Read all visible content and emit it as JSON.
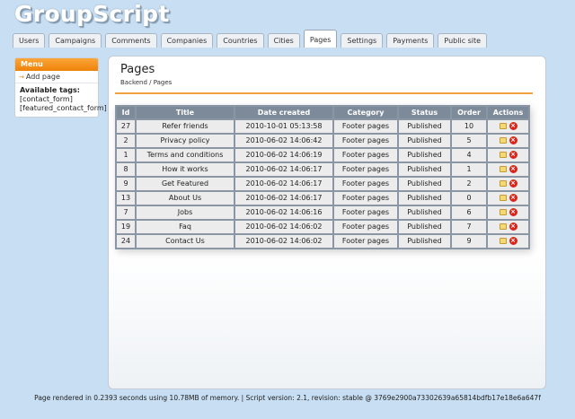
{
  "app": {
    "logo": "GroupScript"
  },
  "tabs": [
    {
      "label": "Users",
      "active": false
    },
    {
      "label": "Campaigns",
      "active": false
    },
    {
      "label": "Comments",
      "active": false
    },
    {
      "label": "Companies",
      "active": false
    },
    {
      "label": "Countries",
      "active": false
    },
    {
      "label": "Cities",
      "active": false
    },
    {
      "label": "Pages",
      "active": true
    },
    {
      "label": "Settings",
      "active": false
    },
    {
      "label": "Payments",
      "active": false
    },
    {
      "label": "Public site",
      "active": false
    }
  ],
  "sidebar": {
    "menu_title": "Menu",
    "add_page": "Add page",
    "tags_label": "Available tags:",
    "tags": [
      "[contact_form]",
      "[featured_contact_form]"
    ]
  },
  "main": {
    "title": "Pages",
    "breadcrumb": "Backend / Pages"
  },
  "table": {
    "headers": [
      "Id",
      "Title",
      "Date created",
      "Category",
      "Status",
      "Order",
      "Actions"
    ],
    "rows": [
      {
        "id": "27",
        "title": "Refer friends",
        "date": "2010-10-01 05:13:58",
        "category": "Footer pages",
        "status": "Published",
        "order": "10"
      },
      {
        "id": "2",
        "title": "Privacy policy",
        "date": "2010-06-02 14:06:42",
        "category": "Footer pages",
        "status": "Published",
        "order": "5"
      },
      {
        "id": "1",
        "title": "Terms and conditions",
        "date": "2010-06-02 14:06:19",
        "category": "Footer pages",
        "status": "Published",
        "order": "4"
      },
      {
        "id": "8",
        "title": "How it works",
        "date": "2010-06-02 14:06:17",
        "category": "Footer pages",
        "status": "Published",
        "order": "1"
      },
      {
        "id": "9",
        "title": "Get Featured",
        "date": "2010-06-02 14:06:17",
        "category": "Footer pages",
        "status": "Published",
        "order": "2"
      },
      {
        "id": "13",
        "title": "About Us",
        "date": "2010-06-02 14:06:17",
        "category": "Footer pages",
        "status": "Published",
        "order": "0"
      },
      {
        "id": "7",
        "title": "Jobs",
        "date": "2010-06-02 14:06:16",
        "category": "Footer pages",
        "status": "Published",
        "order": "6"
      },
      {
        "id": "19",
        "title": "Faq",
        "date": "2010-06-02 14:06:02",
        "category": "Footer pages",
        "status": "Published",
        "order": "7"
      },
      {
        "id": "24",
        "title": "Contact Us",
        "date": "2010-06-02 14:06:02",
        "category": "Footer pages",
        "status": "Published",
        "order": "9"
      }
    ],
    "actions": {
      "edit_icon": "edit-icon",
      "delete_icon": "delete-icon"
    }
  },
  "footer": {
    "text": "Page rendered in 0.2393 seconds using 10.78MB of memory. | Script version: 2.1, revision: stable @ 3769e2900a73302639a65814bdfb17e18e6a647f"
  },
  "colors": {
    "accent": "#ef8208",
    "background": "#c8def2",
    "table_header": "#7d8a9a"
  }
}
